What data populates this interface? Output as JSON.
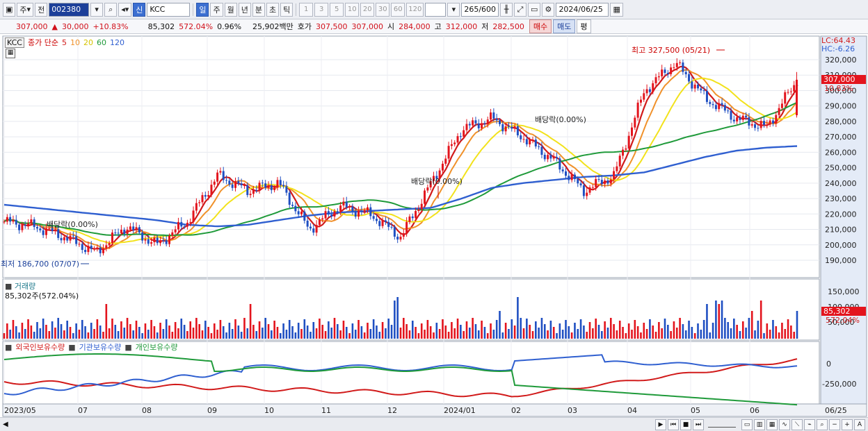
{
  "toolbar": {
    "period_label": "주",
    "prev_label": "전",
    "stock_code": "002380",
    "market_badge": "신",
    "stock_name": "KCC",
    "period_tabs": [
      "일",
      "주",
      "월",
      "년",
      "분",
      "초",
      "틱"
    ],
    "active_tab": "일",
    "interval_buttons": [
      "1",
      "3",
      "5",
      "10",
      "20",
      "30",
      "60",
      "120"
    ],
    "bar_count": "265",
    "bar_max": "/600",
    "date_value": "2024/06/25"
  },
  "quote": {
    "price": "307,000",
    "change_arrow": "▲",
    "change": "30,000",
    "change_pct": "+10.83%",
    "volume": "85,302",
    "volume_ratio": "572.04%",
    "turnover_pct": "0.96%",
    "amount": "25,902백만",
    "quote_label": "호가",
    "ask": "307,500",
    "bid": "307,000",
    "open_label": "시",
    "open": "284,000",
    "high_label": "고",
    "high": "312,000",
    "low_label": "저",
    "low": "282,500",
    "buy_label": "매수",
    "sell_label": "매도",
    "avg_label": "평"
  },
  "price_panel": {
    "ticker_tag": "KCC",
    "legend_title": "종가 단순",
    "ma_periods": [
      "5",
      "10",
      "20",
      "60",
      "120"
    ],
    "ma_colors": [
      "#d11a1a",
      "#f0912a",
      "#f2e21c",
      "#1f9a3a",
      "#2f5fd0"
    ],
    "lc_label": "LC:64.43",
    "hc_label": "HC:-6.26",
    "high_annotation": "최고 327,500 (05/21)",
    "low_annotation": "최저 186,700 (07/07)",
    "dividend_labels": [
      "배당락(0.00%)",
      "배당락(0.00%)",
      "배당락(0.00%)"
    ],
    "price_tag": "307,000",
    "pct_tag": "10.83%",
    "y_ticks": [
      "320,000",
      "310,000",
      "300,000",
      "290,000",
      "280,000",
      "270,000",
      "260,000",
      "250,000",
      "240,000",
      "230,000",
      "220,000",
      "210,000",
      "200,000",
      "190,000"
    ]
  },
  "volume_panel": {
    "title": "거래량",
    "subtitle": "85,302주(572.04%)",
    "y_ticks": [
      "150,000",
      "100,000",
      "50,000"
    ],
    "vol_tag": "85,302",
    "vol_pct_tag": "572.04%"
  },
  "holding_panel": {
    "series_labels": [
      "외국인보유수량",
      "기관보유수량",
      "개인보유수량"
    ],
    "series_colors": [
      "#d11a1a",
      "#2f5fd0",
      "#1f9a3a"
    ],
    "y_ticks": [
      "0",
      "-250,000"
    ]
  },
  "x_axis": {
    "labels": [
      "2023/05",
      "07",
      "08",
      "09",
      "10",
      "11",
      "12",
      "2024/01",
      "02",
      "03",
      "04",
      "05",
      "06"
    ],
    "right_label": "06/25"
  },
  "chart_data": {
    "type": "line",
    "title": "KCC",
    "x_labels": [
      "2023/05",
      "07",
      "08",
      "09",
      "10",
      "11",
      "12",
      "2024/01",
      "02",
      "03",
      "04",
      "05",
      "06"
    ],
    "ylim": [
      186700,
      327500
    ],
    "series": [
      {
        "name": "종가",
        "values": [
          215000,
          212000,
          205000,
          195000,
          212000,
          200000,
          215000,
          245000,
          235000,
          240000,
          210000,
          225000,
          220000,
          205000,
          240000,
          275000,
          282000,
          270000,
          255000,
          235000,
          245000,
          300000,
          318000,
          295000,
          282000,
          276000,
          307000
        ]
      },
      {
        "name": "120",
        "values": [
          226000,
          224000,
          222000,
          220000,
          218000,
          216000,
          213000,
          212000,
          213000,
          216000,
          219000,
          221000,
          222000,
          223000,
          224000,
          230000,
          237000,
          240000,
          242000,
          244000,
          245000,
          247000,
          252000,
          257000,
          261000,
          263000,
          264000
        ]
      }
    ]
  }
}
